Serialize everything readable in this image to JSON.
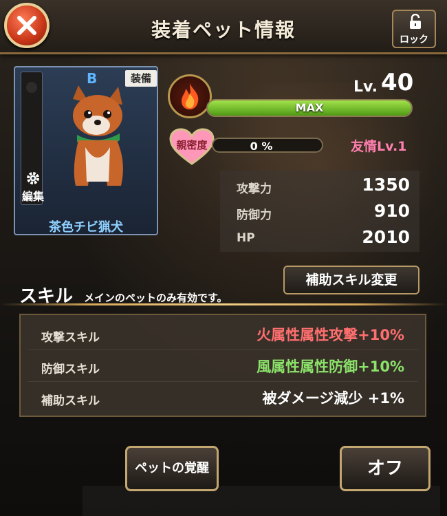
{
  "header": {
    "title": "装着ペット情報",
    "lock_label": "ロック"
  },
  "pet": {
    "rank": "B",
    "equip_badge": "装備",
    "edit_label": "編集",
    "name": "茶色チビ猟犬",
    "level_label": "Lv.",
    "level": "40",
    "exp_text": "MAX",
    "exp_ratio": 1.0,
    "intimacy_label": "親密度",
    "intimacy_text": "0 %",
    "friendship": "友情Lv.1",
    "element": "fire",
    "stats": [
      {
        "label": "攻撃力",
        "value": "1350"
      },
      {
        "label": "防御力",
        "value": "910"
      },
      {
        "label": "HP",
        "value": "2010"
      }
    ]
  },
  "skills": {
    "change_button": "補助スキル変更",
    "title": "スキル",
    "note": "メインのペットのみ有効です。",
    "rows": [
      {
        "label": "攻撃スキル",
        "value": "火属性属性攻撃+10%",
        "color": "#ff6f6f"
      },
      {
        "label": "防御スキル",
        "value": "風属性属性防御+10%",
        "color": "#8be36a"
      },
      {
        "label": "補助スキル",
        "value": "被ダメージ減少 +1%",
        "color": "#ffffff"
      }
    ]
  },
  "buttons": {
    "awaken": "ペットの覚醒",
    "off": "オフ"
  },
  "colors": {
    "frame_gold": "#c4a670",
    "exp_green": "#7cc531",
    "rank_blue": "#5fb6ff"
  }
}
